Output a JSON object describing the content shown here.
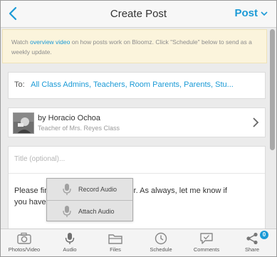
{
  "header": {
    "title": "Create Post",
    "post_label": "Post"
  },
  "info": {
    "text_before": "Watch ",
    "link": "overview video",
    "text_after": " on how posts work on Bloomz. Click \"Schedule\" below to send as a weekly update."
  },
  "recipients": {
    "label": "To:",
    "value": "All Class Admins, Teachers, Room Parents, Parents, Stu..."
  },
  "author": {
    "name": "by Horacio Ochoa",
    "subtitle": "Teacher of Mrs. Reyes Class"
  },
  "compose": {
    "title_placeholder": "Title (optional)...",
    "body_line1": "Please find the attached newsletter. As always, let me know if",
    "body_line2": "you have any questions."
  },
  "audio_menu": {
    "items": [
      {
        "label": "Record Audio",
        "icon": "microphone-icon"
      },
      {
        "label": "Attach Audio",
        "icon": "microphone-icon"
      }
    ]
  },
  "toolbar": {
    "items": [
      {
        "label": "Photos/Video",
        "icon": "camera-icon"
      },
      {
        "label": "Audio",
        "icon": "microphone-icon"
      },
      {
        "label": "Files",
        "icon": "folder-icon"
      },
      {
        "label": "Schedule",
        "icon": "clock-icon"
      },
      {
        "label": "Comments",
        "icon": "comment-icon"
      },
      {
        "label": "Share",
        "icon": "share-icon",
        "badge": "0"
      }
    ]
  },
  "colors": {
    "accent": "#1b9ad6",
    "info_background": "#fbf4dc"
  }
}
